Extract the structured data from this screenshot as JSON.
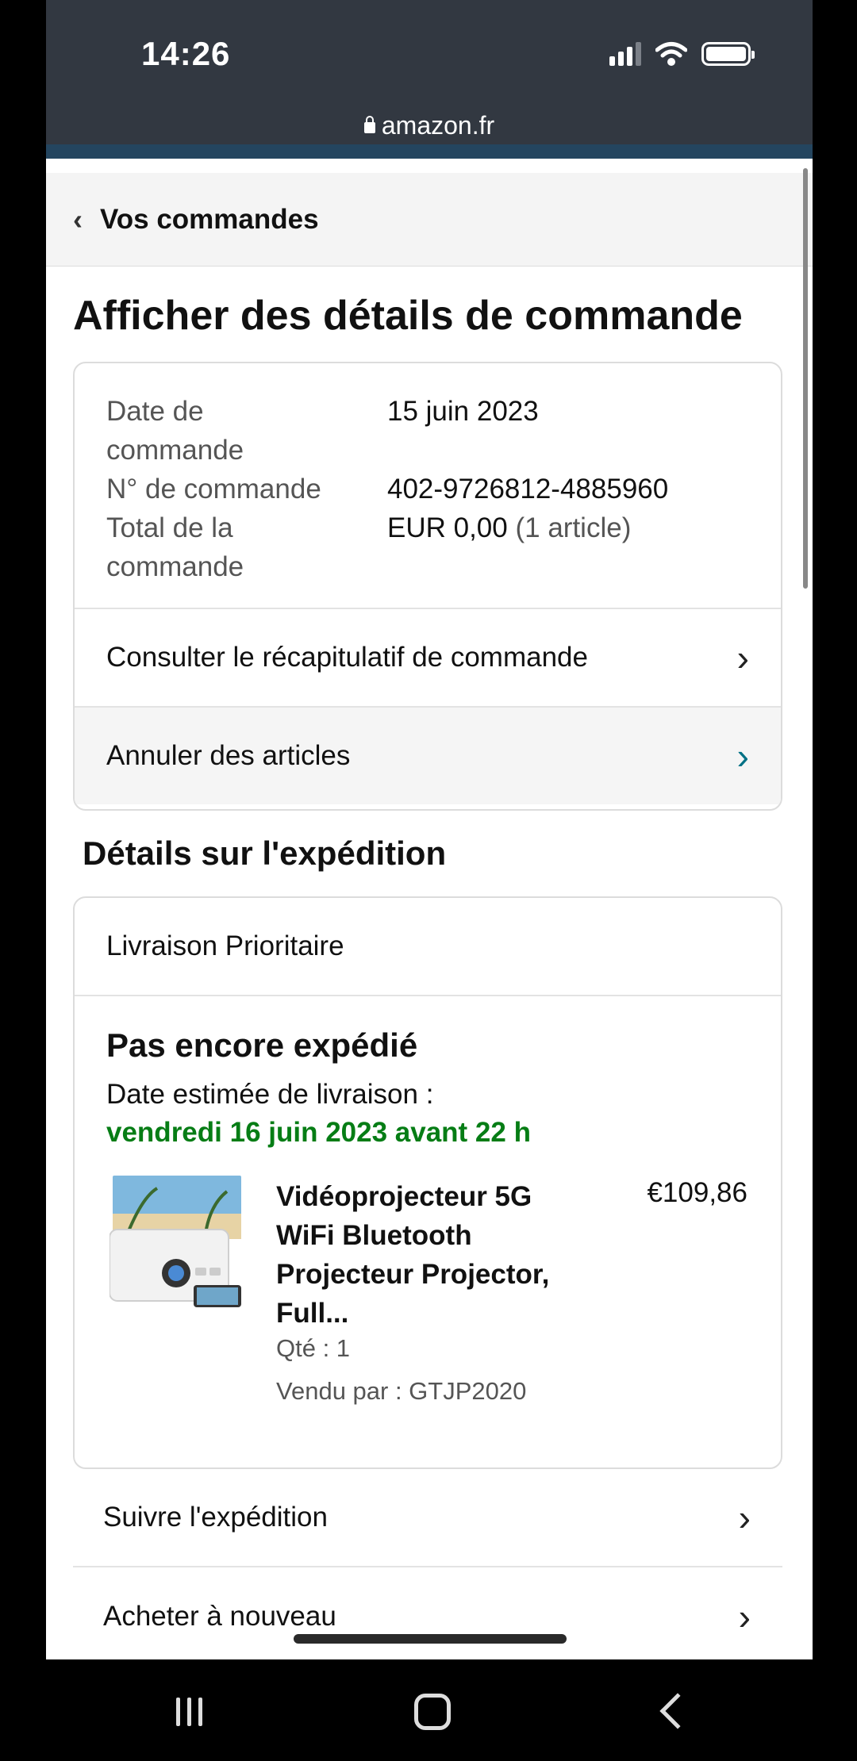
{
  "status_bar": {
    "time": "14:26"
  },
  "browser": {
    "url": "amazon.fr"
  },
  "nav": {
    "back_label": "Vos commandes"
  },
  "page": {
    "title": "Afficher des détails de commande"
  },
  "order": {
    "date_label": "Date de commande",
    "date_value": "15 juin 2023",
    "number_label": "N° de commande",
    "number_value": "402-9726812-4885960",
    "total_label": "Total de la commande",
    "total_value": "EUR 0,00",
    "total_items": "(1 article)",
    "summary_link": "Consulter le récapitulatif de commande",
    "cancel_link": "Annuler des articles"
  },
  "shipment": {
    "section_title": "Détails sur l'expédition",
    "type": "Livraison Prioritaire",
    "status": "Pas encore expédié",
    "estimate_label": "Date estimée de livraison :",
    "estimate_date": "vendredi 16 juin 2023 avant 22 h",
    "product": {
      "title": "Vidéoprojecteur 5G WiFi Bluetooth Projecteur Projector, Full...",
      "price": "€109,86",
      "qty": "Qté : 1",
      "seller": "Vendu par : GTJP2020"
    }
  },
  "actions": {
    "track": "Suivre l'expédition",
    "buy_again": "Acheter à nouveau"
  },
  "icons": {
    "lock": "lock-icon",
    "chevron_left": "chevron-left-icon",
    "chevron_right": "chevron-right-icon"
  },
  "colors": {
    "topbar": "#323841",
    "delivery_green": "#067d15",
    "link_teal": "#007185"
  }
}
